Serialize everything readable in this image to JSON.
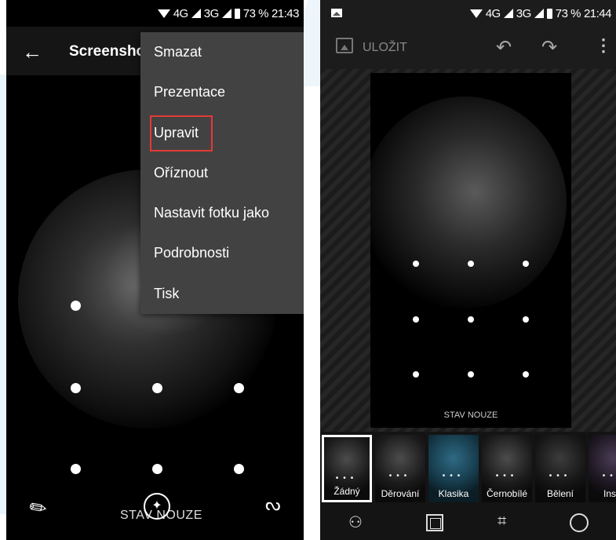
{
  "left": {
    "status": {
      "network": "4G",
      "network2": "3G",
      "battery": "73 %",
      "time": "21:43"
    },
    "toolbar": {
      "title": "Screensho"
    },
    "menu": [
      "Smazat",
      "Prezentace",
      "Upravit",
      "Oříznout",
      "Nastavit fotku jako",
      "Podrobnosti",
      "Tisk"
    ],
    "highlighted_item": "Upravit",
    "emergency": "STAV NOUZE"
  },
  "right": {
    "status": {
      "network": "4G",
      "network2": "3G",
      "battery": "73 %",
      "time": "21:44"
    },
    "toolbar": {
      "save_label": "ULOŽIT"
    },
    "emergency": "STAV NOUZE",
    "filters": [
      "Žádný",
      "Děrování",
      "Klasika",
      "Černobílé",
      "Bělení",
      "Insta"
    ],
    "selected_filter": "Žádný"
  }
}
